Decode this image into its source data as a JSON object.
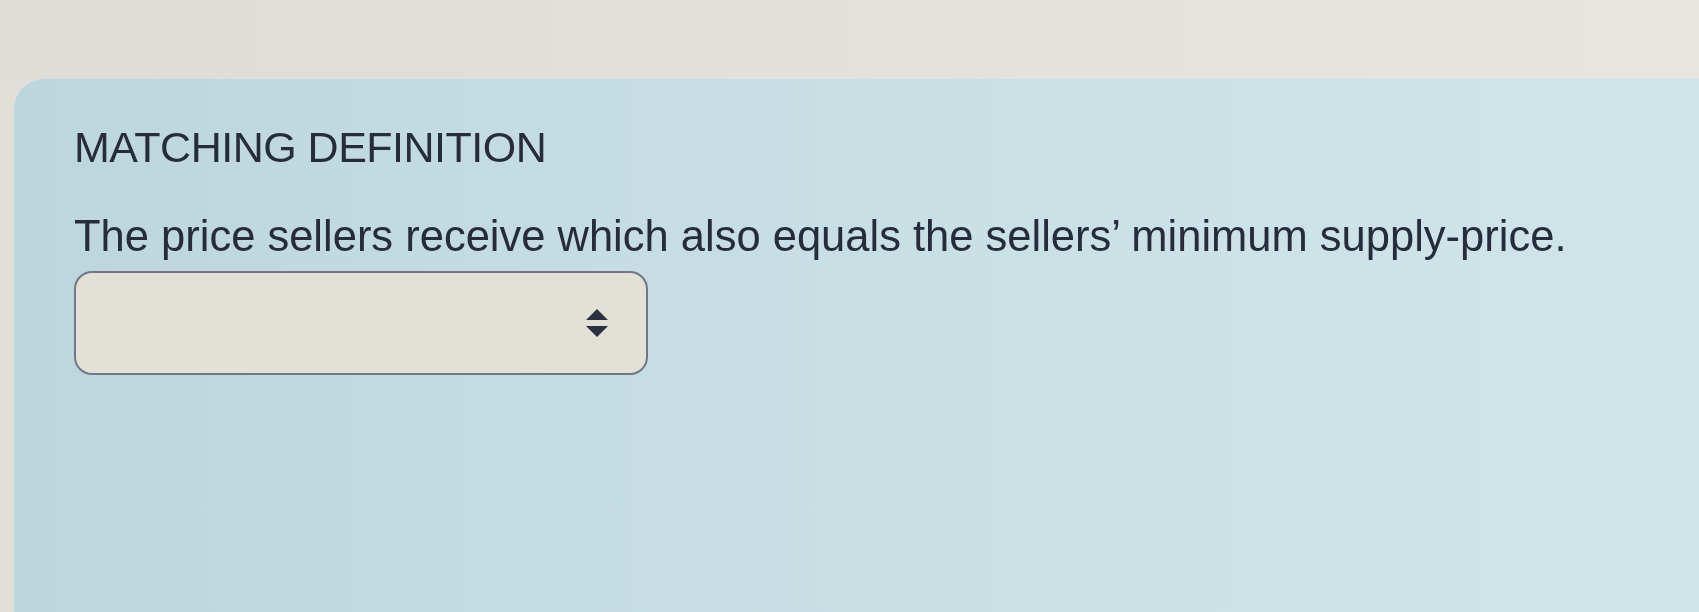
{
  "question": {
    "title": "MATCHING DEFINITION",
    "definition": "The price sellers receive which also equals the sellers’ minimum supply-price.",
    "answer": {
      "kind": "select"
    }
  }
}
